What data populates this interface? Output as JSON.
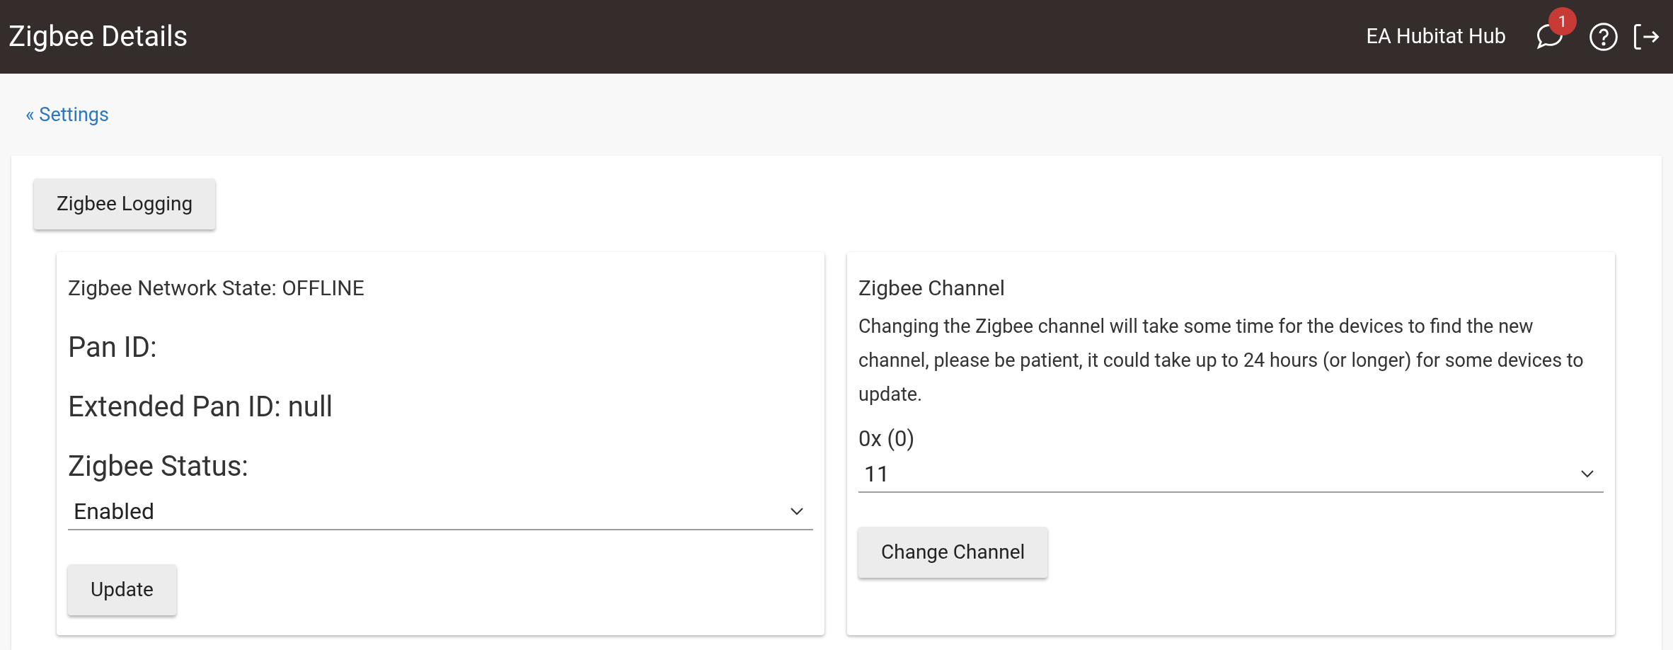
{
  "header": {
    "title": "Zigbee Details",
    "hub_name": "EA Hubitat Hub",
    "notification_count": "1"
  },
  "back_link": "« Settings",
  "logging_button": "Zigbee Logging",
  "network_card": {
    "state": "Zigbee Network State: OFFLINE",
    "pan_id": "Pan ID:",
    "extended_pan_id": "Extended Pan ID: null",
    "status_label": "Zigbee Status:",
    "status_value": "Enabled",
    "button": "Update"
  },
  "channel_card": {
    "title": "Zigbee Channel",
    "description": "Changing the Zigbee channel will take some time for the devices to find the new channel, please be patient, it could take up to 24 hours (or longer) for some devices to update.",
    "select_label": "0x (0)",
    "select_value": "11",
    "button": "Change Channel"
  }
}
